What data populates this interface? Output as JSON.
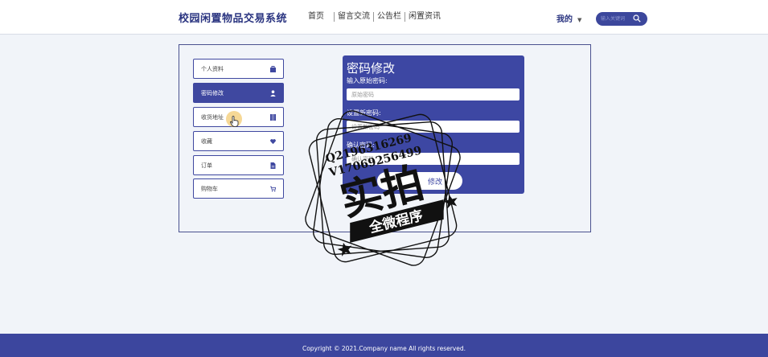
{
  "header": {
    "title": "校园闲置物品交易系统",
    "nav": [
      "首页",
      "留言交流",
      "公告栏",
      "闲置资讯"
    ],
    "me": "我的",
    "search_placeholder": "输入关键词"
  },
  "sidebar": {
    "items": [
      {
        "label": "个人资料",
        "icon": "briefcase-icon",
        "active": false
      },
      {
        "label": "密码修改",
        "icon": "user-icon",
        "active": true
      },
      {
        "label": "收货地址",
        "icon": "map-icon",
        "active": false
      },
      {
        "label": "收藏",
        "icon": "heart-icon",
        "active": false
      },
      {
        "label": "订单",
        "icon": "document-icon",
        "active": false
      },
      {
        "label": "购物车",
        "icon": "cart-icon",
        "active": false
      }
    ]
  },
  "form": {
    "title": "密码修改",
    "old_label": "输入原始密码:",
    "old_placeholder": "原始密码",
    "new_label": "设置新密码:",
    "new_placeholder": "设置新密码",
    "confirm_label": "确认密码:",
    "confirm_placeholder": "确认密码",
    "submit": "修改"
  },
  "watermark": {
    "line1": "Q2196316269",
    "line2": "V17069256499",
    "big": "实拍",
    "banner": "全微程序"
  },
  "footer": {
    "copyright": "Copyright © 2021.Company name All rights reserved."
  },
  "colors": {
    "primary": "#3d47a3",
    "title": "#2a3480",
    "background": "#f1f4f9"
  }
}
